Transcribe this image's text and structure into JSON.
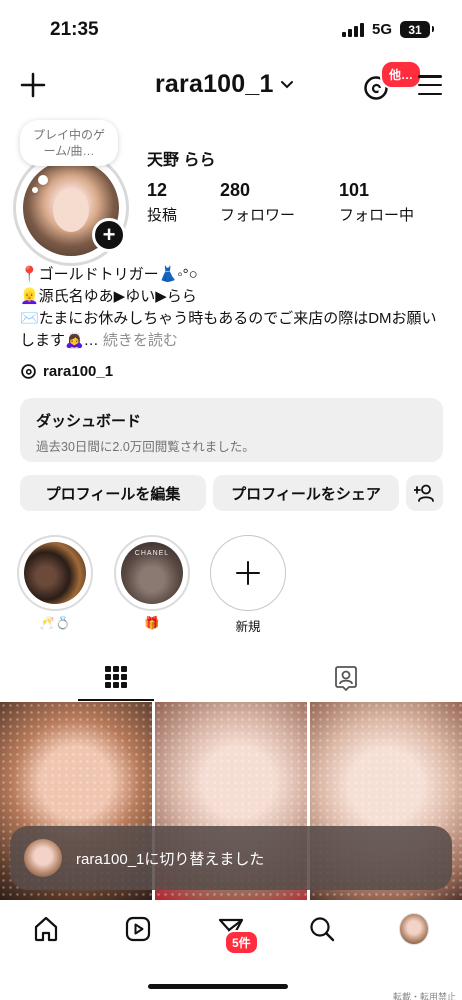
{
  "status_bar": {
    "time": "21:35",
    "network": "5G",
    "battery": "31"
  },
  "header": {
    "username": "rara100_1",
    "threads_badge": "他…",
    "icons": {
      "create": "plus-icon",
      "account_switch": "chevron-down-icon",
      "threads": "threads-icon",
      "menu": "hamburger-menu-icon"
    }
  },
  "profile": {
    "note": "プレイ中のゲーム/曲…",
    "display_name": "天野 らら",
    "stats": [
      {
        "value": "12",
        "label": "投稿"
      },
      {
        "value": "280",
        "label": "フォロワー"
      },
      {
        "value": "101",
        "label": "フォロー中"
      }
    ],
    "bio_lines": [
      "📍ゴールドトリガー👗◦°○",
      "👱‍♀️源氏名ゆあ▶ゆい▶らら",
      "✉️たまにお休みしちゃう時もあるのでご来店の際はDMお願いします🙇‍♀️…"
    ],
    "bio_more": "続きを読む",
    "threads_handle": "rara100_1"
  },
  "dashboard": {
    "title": "ダッシュボード",
    "subtitle": "過去30日間に2.0万回閲覧されました。"
  },
  "actions": {
    "edit": "プロフィールを編集",
    "share": "プロフィールをシェア"
  },
  "highlights": [
    {
      "label": "🥂💍",
      "thumb_text": ""
    },
    {
      "label": "🎁",
      "thumb_text": "CHANEL"
    },
    {
      "label": "新規"
    }
  ],
  "tabs": [
    {
      "name": "posts-grid",
      "icon": "grid-icon",
      "active": true
    },
    {
      "name": "tagged",
      "icon": "tagged-user-icon",
      "active": false
    }
  ],
  "toast": {
    "text": "rara100_1に切り替えました"
  },
  "bottom_nav": {
    "items": [
      "home-icon",
      "reels-icon",
      "messages-icon",
      "search-icon",
      "profile-avatar"
    ],
    "messages_badge": "5件"
  },
  "watermark": "転載・転用禁止",
  "colors": {
    "badge_red": "#ff2d3d",
    "button_gray": "#efefef",
    "muted_text": "#737373"
  }
}
